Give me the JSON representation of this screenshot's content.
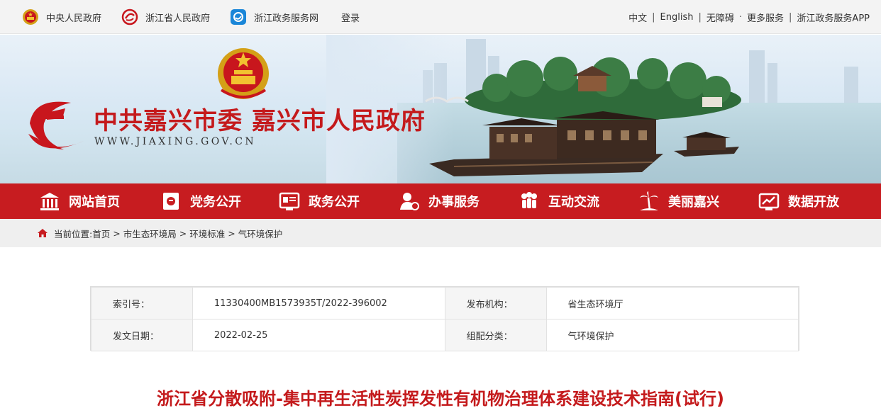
{
  "topbar": {
    "links": [
      {
        "label": "中央人民政府",
        "icon": "national-emblem-icon"
      },
      {
        "label": "浙江省人民政府",
        "icon": "zhejiang-logo-icon"
      },
      {
        "label": "浙江政务服务网",
        "icon": "service-net-icon"
      }
    ],
    "login_label": "登录",
    "right": {
      "chinese": "中文",
      "english": "English",
      "accessible": "无障碍",
      "more": "更多服务",
      "app": "浙江政务服务APP",
      "sep": "|",
      "dot": "·"
    }
  },
  "banner": {
    "title": "中共嘉兴市委 嘉兴市人民政府",
    "url": "WWW.JIAXING.GOV.CN"
  },
  "nav": {
    "items": [
      {
        "label": "网站首页",
        "icon": "home-building-icon"
      },
      {
        "label": "党务公开",
        "icon": "party-document-icon"
      },
      {
        "label": "政务公开",
        "icon": "gov-screen-icon"
      },
      {
        "label": "办事服务",
        "icon": "person-service-icon"
      },
      {
        "label": "互动交流",
        "icon": "people-group-icon"
      },
      {
        "label": "美丽嘉兴",
        "icon": "palm-tree-icon"
      },
      {
        "label": "数据开放",
        "icon": "data-chart-icon"
      }
    ]
  },
  "breadcrumb": {
    "prefix": "当前位置:",
    "items": [
      "首页",
      "市生态环境局",
      "环境标准",
      "气环境保护"
    ],
    "sep": ">"
  },
  "meta": {
    "rows": [
      {
        "k1": "索引号：",
        "v1": "11330400MB1573935T/2022-396002",
        "k2": "发布机构：",
        "v2": "省生态环境厅"
      },
      {
        "k1": "发文日期：",
        "v1": "2022-02-25",
        "k2": "组配分类：",
        "v2": "气环境保护"
      }
    ]
  },
  "article": {
    "title": "浙江省分散吸附-集中再生活性炭挥发性有机物治理体系建设技术指南(试行)"
  },
  "colors": {
    "brand_red": "#c71c20",
    "title_red": "#c41a1c"
  }
}
